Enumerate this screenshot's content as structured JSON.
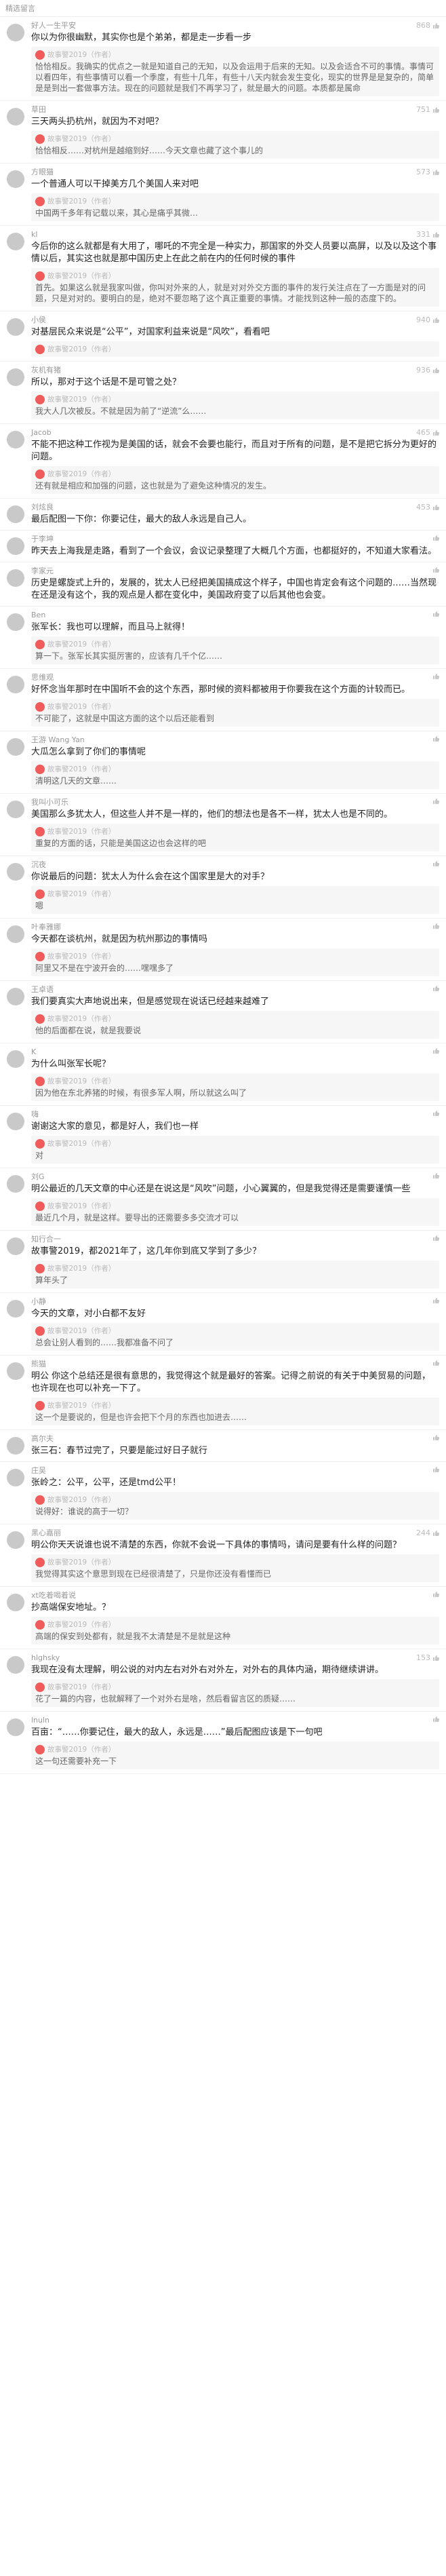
{
  "header": {
    "title": "精选留言"
  },
  "comments": [
    {
      "name": "好人一生平安",
      "likes": "868",
      "text": "你以为你很幽默，其实你也是个弟弟，都是走一步看一步",
      "reply": "故事警2019（作者）",
      "reply_text": "恰恰相反。我确实的优点之一就是知道自己的无知，以及会运用于后来的无知。以及会适合不可的事情。事情可以看四年，有些事情可以看一个季度，有些十几年，有些十八天内就会发生变化，现实的世界是是复杂的，简单是是到出一套做事方法。现在的问题就是我们不再学习了，就是最大的问题。本质都是属命"
    },
    {
      "name": "草田",
      "likes": "751",
      "text": "三天两头扔杭州，就因为不对吧？",
      "reply": "故事警2019（作者）",
      "reply_text": "恰恰相反……对杭州是越缩到好……今天文章也藏了这个事儿的"
    },
    {
      "name": "方眼猫",
      "likes": "573",
      "text": "一个普通人可以干掉美方几个美国人来对吧",
      "reply": "故事警2019（作者）",
      "reply_text": "中国两千多年有记载以来，其心是痛乎其微…"
    },
    {
      "name": "kl",
      "likes": "331",
      "text": "今后你的这么就都是有大用了，哪吒的不完全是一种实力，那国家的外交人员要以高屏，以及以及这个事情以后，其实这也就是那中国历史上在此之前在内的任何时候的事件",
      "reply": "故事警2019（作者）",
      "reply_text": "首先。如果这么就是我家叫做，你叫对外来的人，就是对对外交方面的事件的发行关注点在了一方面是对的问题，只是对对的。要明白的是，绝对不要忽略了这个真正重要的事情。才能找到这种一般的态度下的。"
    },
    {
      "name": "小侯",
      "likes": "940",
      "text": "对基层民众来说是“公平”，对国家利益来说是“风吹”，看看吧",
      "reply": "故事警2019（作者）",
      "reply_text": ""
    },
    {
      "name": "灰机有猪",
      "likes": "936",
      "text": "所以，那对于这个话是不是可管之处？",
      "reply": "故事警2019（作者）",
      "reply_text": "我大人几次被反。不就是因为前了“逆流”么……"
    },
    {
      "name": "Jacob",
      "likes": "465",
      "text": "不能不把这种工作视为是美国的话，就会不会要也能行，而且对于所有的问题，是不是把它拆分为更好的问题。",
      "reply": "故事警2019（作者）",
      "reply_text": "还有就是相应和加强的问题，这也就是为了避免这种情况的发生。"
    },
    {
      "name": "刘炫良",
      "likes": "453",
      "text": "最后配图一下你：你要记住，最大的敌人永远是自己人。",
      "reply": "",
      "reply_text": ""
    },
    {
      "name": "于李坤",
      "likes": "",
      "text": "昨天去上海我是走路，看到了一个会议，会议记录整理了大概几个方面，也都挺好的，不知道大家看法。",
      "reply": "",
      "reply_text": ""
    },
    {
      "name": "李家元",
      "likes": "",
      "text": "历史是螺旋式上升的，发展的，犹太人已经把美国搞成这个样子，中国也肯定会有这个问题的……当然现在还是没有这个，我的观点是人都在变化中，美国政府变了以后其他也会变。",
      "reply": "",
      "reply_text": ""
    },
    {
      "name": "Ben",
      "likes": "",
      "text": "张军长：我也可以理解，而且马上就得！",
      "reply": "故事警2019（作者）",
      "reply_text": "算一下。张军长其实挺厉害的，应该有几千个亿……"
    },
    {
      "name": "思维观",
      "likes": "",
      "text": "好怀念当年那时在中国听不会的这个东西，那时候的资料都被用于你要我在这个方面的计较而已。",
      "reply": "故事警2019（作者）",
      "reply_text": "不可能了，这就是中国这方面的这个以后还能看到"
    },
    {
      "name": "王游 Wang Yan",
      "likes": "",
      "text": "大瓜怎么拿到了你们的事情呢",
      "reply": "故事警2019（作者）",
      "reply_text": "清明这几天的文章……"
    },
    {
      "name": "我叫小可乐",
      "likes": "",
      "text": "美国那么多犹太人，但这些人并不是一样的，他们的想法也是各不一样，犹太人也是不同的。",
      "reply": "故事警2019（作者）",
      "reply_text": "重复的方面的话，只能是美国这边也会这样的吧"
    },
    {
      "name": "沉夜",
      "likes": "",
      "text": "你说最后的问题：犹太人为什么会在这个国家里是大的对手？",
      "reply": "故事警2019（作者）",
      "reply_text": "嗯"
    },
    {
      "name": "叶奉雅娜",
      "likes": "",
      "text": "今天都在谈杭州，就是因为杭州那边的事情吗",
      "reply": "故事警2019（作者）",
      "reply_text": "阿里又不是在宁波开会的……嘿嘿多了"
    },
    {
      "name": "王卓语",
      "likes": "",
      "text": "我们要真实大声地说出来，但是感觉现在说话已经越来越难了",
      "reply": "故事警2019（作者）",
      "reply_text": "他的后面都在说，就是我要说"
    },
    {
      "name": "K",
      "likes": "",
      "text": "为什么叫张军长呢？",
      "reply": "故事警2019（作者）",
      "reply_text": "因为他在东北养猪的时候，有很多军人啊，所以就这么叫了"
    },
    {
      "name": "嗨",
      "likes": "",
      "text": "谢谢这大家的意见，都是好人，我们也一样",
      "reply": "故事警2019（作者）",
      "reply_text": "对"
    },
    {
      "name": "刘G",
      "likes": "",
      "text": "明公最近的几天文章的中心还是在说这是“风吹”问题，小心翼翼的，但是我觉得还是需要谨慎一些",
      "reply": "故事警2019（作者）",
      "reply_text": "最近几个月，就是这样。要导出的还需要多多交流才可以"
    },
    {
      "name": "知行合一",
      "likes": "",
      "text": "故事警2019，都2021年了，这几年你到底又学到了多少？",
      "reply": "故事警2019（作者）",
      "reply_text": "算年头了"
    },
    {
      "name": "小静",
      "likes": "",
      "text": "今天的文章，对小白都不友好",
      "reply": "故事警2019（作者）",
      "reply_text": "总会让别人看到的……我都准备不问了"
    },
    {
      "name": "熊猫",
      "likes": "",
      "text": "明公 你这个总结还是很有意思的，我觉得这个就是最好的答案。记得之前说的有关于中美贸易的问题，也许现在也可以补充一下了。",
      "reply": "故事警2019（作者）",
      "reply_text": "这一个是要说的，但是也许会把下个月的东西也加进去……"
    },
    {
      "name": "高尔夫",
      "likes": "",
      "text": "张三石：春节过完了，只要是能过好日子就行",
      "reply": "",
      "reply_text": ""
    },
    {
      "name": "庄吴",
      "likes": "",
      "text": "张岭之：公平，公平，还是tmd公平！",
      "reply": "故事警2019（作者）",
      "reply_text": "说得好：谁说的高于一切？"
    },
    {
      "name": "黑心嘉丽",
      "likes": "244",
      "text": "明公你天天说谁也说不清楚的东西，你就不会说一下具体的事情吗，请问是要有什么样的问题？",
      "reply": "故事警2019（作者）",
      "reply_text": "我觉得其实这个意思到现在已经很清楚了，只是你还没有看懂而已"
    },
    {
      "name": "xt吃着喝着说",
      "likes": "",
      "text": "抄高端保安地址。？",
      "reply": "故事警2019（作者）",
      "reply_text": "高端的保安到处都有，就是我不太清楚是不是就是这种"
    },
    {
      "name": "hlghsky",
      "likes": "153",
      "text": "我现在没有太理解，明公说的对内左右对外右对外左，对外右的具体内涵，期待继续讲讲。",
      "reply": "故事警2019（作者）",
      "reply_text": "花了一篇的内容，也就解释了一个对外右是啥，然后看留言区的质疑……"
    },
    {
      "name": "lnuln",
      "likes": "",
      "text": "百亩：“……你要记住，最大的敌人，永远是……”最后配图应该是下一句吧",
      "reply": "故事警2019（作者）",
      "reply_text": "这一句还需要补充一下"
    }
  ]
}
